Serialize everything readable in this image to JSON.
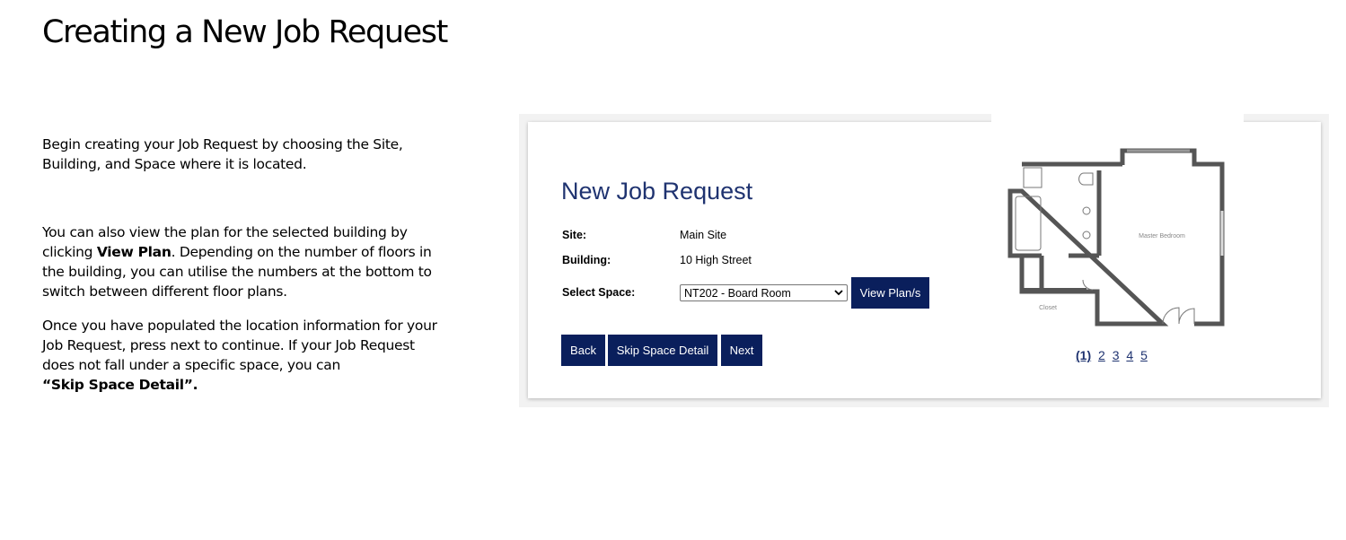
{
  "slide": {
    "title": "Creating a New Job Request",
    "paragraph1": "Begin creating your Job Request by choosing the Site, Building, and Space where it is located.",
    "paragraph2_part1": "You can also view the plan for the selected building by clicking ",
    "paragraph2_bold": "View Plan",
    "paragraph2_part2": ". Depending on the number of floors in the building, you can utilise the numbers at the bottom to switch between different floor plans.",
    "paragraph3": "Once you have populated the location information for your Job Request, press next to continue. If your Job Request does not fall under a specific space, you can",
    "paragraph3_bold": "“Skip Space Detail”."
  },
  "form": {
    "title": "New Job Request",
    "site_label": "Site:",
    "site_value": "Main Site",
    "building_label": "Building:",
    "building_value": "10 High Street",
    "space_label": "Select Space:",
    "space_selected": "NT202 - Board Room",
    "view_plans_label": "View Plan/s",
    "back_label": "Back",
    "skip_label": "Skip Space Detail",
    "next_label": "Next"
  },
  "plan": {
    "room_master": "Master Bedroom",
    "room_closet": "Closet",
    "pages": [
      "(1)",
      "2",
      "3",
      "4",
      "5"
    ]
  },
  "colors": {
    "accent": "#0a1f5c",
    "title_blue": "#1f3370"
  }
}
